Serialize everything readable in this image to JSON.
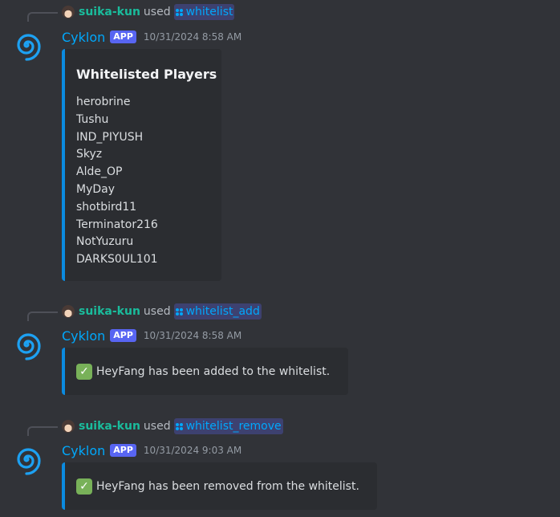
{
  "messages": [
    {
      "command_user": "suika-kun",
      "used_text": "used",
      "command": "whitelist",
      "bot_name": "Cyklon",
      "badge": "APP",
      "timestamp": "10/31/2024 8:58 AM",
      "embed_title": "Whitelisted Players",
      "players": [
        "herobrine",
        "Tushu",
        "IND_PIYUSH",
        "Skyz",
        "Alde_OP",
        "MyDay",
        "shotbird11",
        "Terminator216",
        "NotYuzuru",
        "DARKS0UL101"
      ]
    },
    {
      "command_user": "suika-kun",
      "used_text": "used",
      "command": "whitelist_add",
      "bot_name": "Cyklon",
      "badge": "APP",
      "timestamp": "10/31/2024 8:58 AM",
      "embed_text": "HeyFang has been added to the whitelist."
    },
    {
      "command_user": "suika-kun",
      "used_text": "used",
      "command": "whitelist_remove",
      "bot_name": "Cyklon",
      "badge": "APP",
      "timestamp": "10/31/2024 9:03 AM",
      "embed_text": "HeyFang has been removed from the whitelist."
    }
  ],
  "colors": {
    "background": "#313338",
    "embed_background": "#2b2d31",
    "embed_accent": "#0b8be0",
    "bot_name": "#00a8fc",
    "user_name": "#1abc9c",
    "badge": "#5865f2",
    "check": "#78b159"
  },
  "icons": {
    "bot_avatar": "spiral-icon",
    "command": "slash-command-icon",
    "status": "check-mark-icon"
  }
}
